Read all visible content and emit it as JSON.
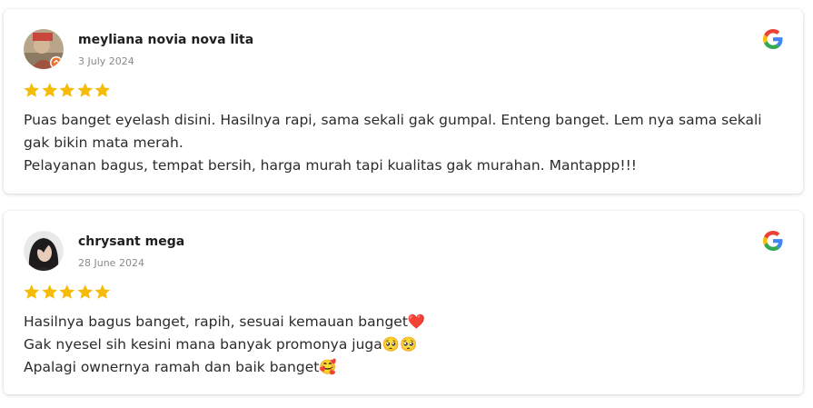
{
  "reviews": [
    {
      "name": "meyliana novia nova lita",
      "date": "3 July 2024",
      "rating": 5,
      "lines": [
        "Puas banget eyelash disini. Hasilnya rapi, sama sekali gak gumpal. Enteng banget. Lem nya sama sekali gak bikin mata merah.",
        "Pelayanan bagus, tempat bersih, harga murah tapi kualitas gak murahan. Mantappp!!!"
      ]
    },
    {
      "name": "chrysant mega",
      "date": "28 June 2024",
      "rating": 5,
      "lines": [
        "Hasilnya bagus banget, rapih, sesuai kemauan banget❤️",
        "Gak nyesel sih kesini mana banyak promonya juga🥺🥺",
        "Apalagi ownernya ramah dan baik banget🥰"
      ]
    }
  ],
  "colors": {
    "star": "#F6BB06",
    "google_blue": "#4285F4",
    "google_red": "#EA4335",
    "google_yellow": "#FBBC05",
    "google_green": "#34A853"
  },
  "icons": {
    "source": "google-g-icon",
    "rating": "star-icon"
  }
}
